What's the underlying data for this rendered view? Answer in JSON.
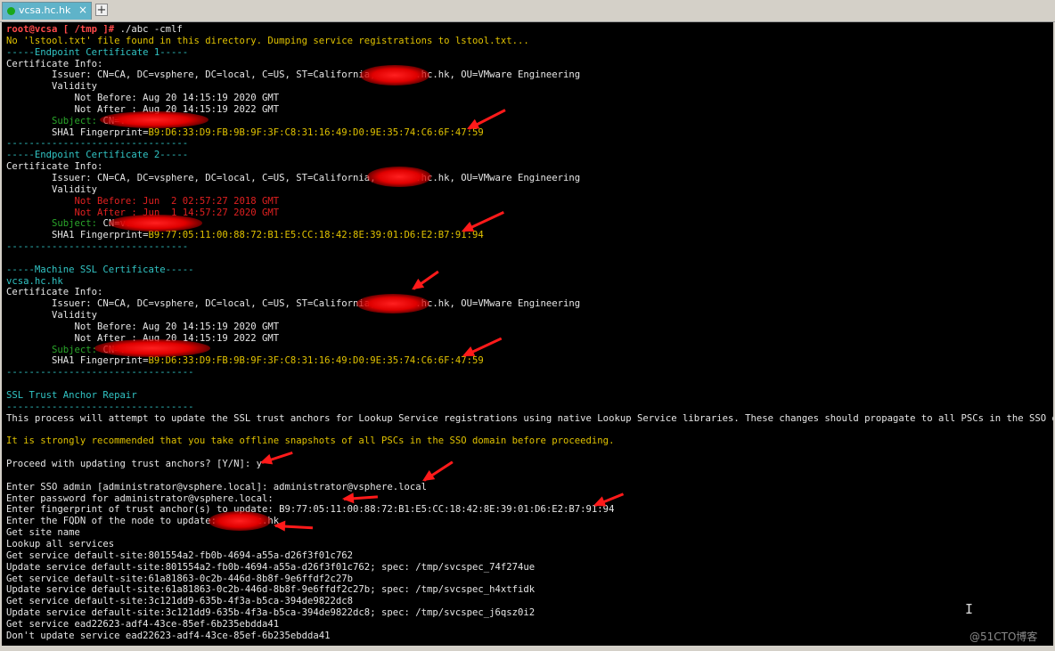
{
  "tabs": [
    {
      "label": "vcsa.hc.hk",
      "close": "×"
    }
  ],
  "new_tab": "+",
  "watermark": "@51CTO博客",
  "cursor": "I",
  "terminal": {
    "lines": [
      [
        {
          "t": "root@vcsa [ /tmp ]# ",
          "c": "pr"
        },
        {
          "t": "./abc -cmlf",
          "c": "g"
        }
      ],
      [
        {
          "t": "No 'lstool.txt' file found in this directory. Dumping service registrations to lstool.txt...",
          "c": "y"
        }
      ],
      [
        {
          "t": "-----Endpoint Certificate 1-----",
          "c": "c"
        }
      ],
      [
        {
          "t": "Certificate Info:",
          "c": "g"
        }
      ],
      [
        {
          "t": "        Issuer: CN=CA, DC=vsphere, DC=local, C=US, ST=California, O=vcsa.hc.hk, OU=VMware Engineering",
          "c": "g"
        }
      ],
      [
        {
          "t": "        Validity",
          "c": "g"
        }
      ],
      [
        {
          "t": "            Not Before: Aug 20 14:15:19 2020 GMT",
          "c": "g"
        }
      ],
      [
        {
          "t": "            Not After : Aug 20 14:15:19 2022 GMT",
          "c": "g"
        }
      ],
      [
        {
          "t": "        Subject: ",
          "c": "dg"
        },
        {
          "t": "CN=vcsa.hc.hk",
          "c": "g"
        }
      ],
      [
        {
          "t": "        SHA1 Fingerprint=",
          "c": "g"
        },
        {
          "t": "B9:D6:33:D9:FB:9B:9F:3F:C8:31:16:49:D0:9E:35:74:C6:6F:47:59",
          "c": "fp"
        }
      ],
      [
        {
          "t": "--------------------------------",
          "c": "c"
        }
      ],
      [
        {
          "t": "-----Endpoint Certificate 2-----",
          "c": "c"
        }
      ],
      [
        {
          "t": "Certificate Info:",
          "c": "g"
        }
      ],
      [
        {
          "t": "        Issuer: CN=CA, DC=vsphere, DC=local, C=US, ST=California, O=vcsa.hc.hk, OU=VMware Engineering",
          "c": "g"
        }
      ],
      [
        {
          "t": "        Validity",
          "c": "g"
        }
      ],
      [
        {
          "t": "            Not Before: Jun  2 02:57:27 2018 GMT",
          "c": "r"
        }
      ],
      [
        {
          "t": "            Not After : Jun  1 14:57:27 2020 GMT",
          "c": "r"
        }
      ],
      [
        {
          "t": "        Subject: ",
          "c": "dg"
        },
        {
          "t": "CN=vcsa.hc.hk",
          "c": "g"
        }
      ],
      [
        {
          "t": "        SHA1 Fingerprint=",
          "c": "g"
        },
        {
          "t": "B9:77:05:11:00:88:72:B1:E5:CC:18:42:8E:39:01:D6:E2:B7:91:94",
          "c": "fp"
        }
      ],
      [
        {
          "t": "--------------------------------",
          "c": "c"
        }
      ],
      [
        {
          "t": "",
          "c": "g"
        }
      ],
      [
        {
          "t": "-----Machine SSL Certificate-----",
          "c": "c"
        }
      ],
      [
        {
          "t": "vcsa.hc.hk",
          "c": "c"
        }
      ],
      [
        {
          "t": "Certificate Info:",
          "c": "g"
        }
      ],
      [
        {
          "t": "        Issuer: CN=CA, DC=vsphere, DC=local, C=US, ST=California, O=vcsa.hc.hk, OU=VMware Engineering",
          "c": "g"
        }
      ],
      [
        {
          "t": "        Validity",
          "c": "g"
        }
      ],
      [
        {
          "t": "            Not Before: Aug 20 14:15:19 2020 GMT",
          "c": "g"
        }
      ],
      [
        {
          "t": "            Not After : Aug 20 14:15:19 2022 GMT",
          "c": "g"
        }
      ],
      [
        {
          "t": "        Subject: ",
          "c": "dg"
        },
        {
          "t": "CN=vcsa.hc.hk",
          "c": "g"
        }
      ],
      [
        {
          "t": "        SHA1 Fingerprint=",
          "c": "g"
        },
        {
          "t": "B9:D6:33:D9:FB:9B:9F:3F:C8:31:16:49:D0:9E:35:74:C6:6F:47:59",
          "c": "fp"
        }
      ],
      [
        {
          "t": "---------------------------------",
          "c": "c"
        }
      ],
      [
        {
          "t": "",
          "c": "g"
        }
      ],
      [
        {
          "t": "SSL Trust Anchor Repair",
          "c": "c"
        }
      ],
      [
        {
          "t": "---------------------------------",
          "c": "c"
        }
      ],
      [
        {
          "t": "This process will attempt to update the SSL trust anchors for Lookup Service registrations using native Lookup Service libraries. These changes should propagate to all PSCs in the SSO domain.",
          "c": "g"
        }
      ],
      [
        {
          "t": "",
          "c": "g"
        }
      ],
      [
        {
          "t": "It is strongly recommended that you take offline snapshots of all PSCs in the SSO domain before proceeding.",
          "c": "y"
        }
      ],
      [
        {
          "t": "",
          "c": "g"
        }
      ],
      [
        {
          "t": "Proceed with updating trust anchors? [Y/N]: y",
          "c": "g"
        }
      ],
      [
        {
          "t": "",
          "c": "g"
        }
      ],
      [
        {
          "t": "Enter SSO admin [administrator@vsphere.local]: administrator@vsphere.local",
          "c": "g"
        }
      ],
      [
        {
          "t": "Enter password for administrator@vsphere.local:",
          "c": "g"
        }
      ],
      [
        {
          "t": "Enter fingerprint of trust anchor(s) to update: B9:77:05:11:00:88:72:B1:E5:CC:18:42:8E:39:01:D6:E2:B7:91:94",
          "c": "g"
        }
      ],
      [
        {
          "t": "Enter the FQDN of the node to update: vcsa.hc.hk",
          "c": "g"
        }
      ],
      [
        {
          "t": "Get site name",
          "c": "g"
        }
      ],
      [
        {
          "t": "Lookup all services",
          "c": "g"
        }
      ],
      [
        {
          "t": "Get service default-site:801554a2-fb0b-4694-a55a-d26f3f01c762",
          "c": "g"
        }
      ],
      [
        {
          "t": "Update service default-site:801554a2-fb0b-4694-a55a-d26f3f01c762; spec: /tmp/svcspec_74f274ue",
          "c": "g"
        }
      ],
      [
        {
          "t": "Get service default-site:61a81863-0c2b-446d-8b8f-9e6ffdf2c27b",
          "c": "g"
        }
      ],
      [
        {
          "t": "Update service default-site:61a81863-0c2b-446d-8b8f-9e6ffdf2c27b; spec: /tmp/svcspec_h4xtfidk",
          "c": "g"
        }
      ],
      [
        {
          "t": "Get service default-site:3c121dd9-635b-4f3a-b5ca-394de9822dc8",
          "c": "g"
        }
      ],
      [
        {
          "t": "Update service default-site:3c121dd9-635b-4f3a-b5ca-394de9822dc8; spec: /tmp/svcspec_j6qsz0i2",
          "c": "g"
        }
      ],
      [
        {
          "t": "Get service ead22623-adf4-43ce-85ef-6b235ebdda41",
          "c": "g"
        }
      ],
      [
        {
          "t": "Don't update service ead22623-adf4-43ce-85ef-6b235ebdda41",
          "c": "g"
        }
      ]
    ]
  }
}
